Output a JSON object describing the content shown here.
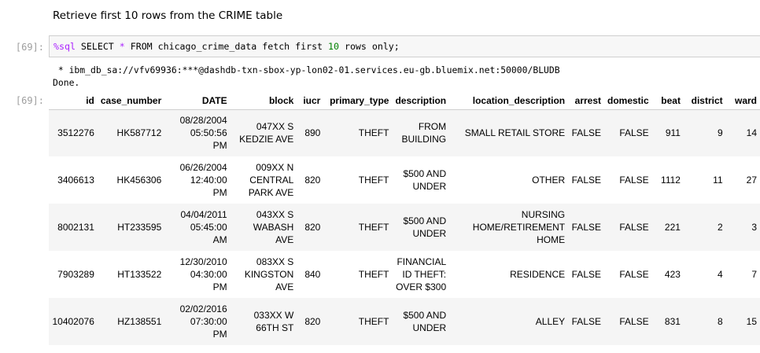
{
  "markdown": {
    "text": "Retrieve first 10 rows from the CRIME table"
  },
  "cell": {
    "in_prompt": "[69]:",
    "out_prompt": "[69]:",
    "code": {
      "magic": "%sql",
      "pre_star": " SELECT ",
      "star": "*",
      "mid": " FROM chicago_crime_data fetch first ",
      "num": "10",
      "post": " rows only;"
    },
    "stream": [
      " * ibm_db_sa://vfv69936:***@dashdb-txn-sbox-yp-lon02-01.services.eu-gb.bluemix.net:50000/BLUDB",
      "Done."
    ]
  },
  "table": {
    "columns": [
      "id",
      "case_number",
      "DATE",
      "block",
      "iucr",
      "primary_type",
      "description",
      "location_description",
      "arrest",
      "domestic",
      "beat",
      "district",
      "ward"
    ],
    "rows": [
      [
        [
          "3512276"
        ],
        [
          "HK587712"
        ],
        [
          "08/28/2004",
          "05:50:56",
          "PM"
        ],
        [
          "047XX S",
          "KEDZIE AVE"
        ],
        [
          "890"
        ],
        [
          "THEFT"
        ],
        [
          "FROM",
          "BUILDING"
        ],
        [
          "SMALL RETAIL STORE"
        ],
        [
          "FALSE"
        ],
        [
          "FALSE"
        ],
        [
          "911"
        ],
        [
          "9"
        ],
        [
          "14"
        ]
      ],
      [
        [
          "3406613"
        ],
        [
          "HK456306"
        ],
        [
          "06/26/2004",
          "12:40:00",
          "PM"
        ],
        [
          "009XX N",
          "CENTRAL",
          "PARK AVE"
        ],
        [
          "820"
        ],
        [
          "THEFT"
        ],
        [
          "$500 AND",
          "UNDER"
        ],
        [
          "OTHER"
        ],
        [
          "FALSE"
        ],
        [
          "FALSE"
        ],
        [
          "1112"
        ],
        [
          "11"
        ],
        [
          "27"
        ]
      ],
      [
        [
          "8002131"
        ],
        [
          "HT233595"
        ],
        [
          "04/04/2011",
          "05:45:00",
          "AM"
        ],
        [
          "043XX S",
          "WABASH AVE"
        ],
        [
          "820"
        ],
        [
          "THEFT"
        ],
        [
          "$500 AND",
          "UNDER"
        ],
        [
          "NURSING",
          "HOME/RETIREMENT",
          "HOME"
        ],
        [
          "FALSE"
        ],
        [
          "FALSE"
        ],
        [
          "221"
        ],
        [
          "2"
        ],
        [
          "3"
        ]
      ],
      [
        [
          "7903289"
        ],
        [
          "HT133522"
        ],
        [
          "12/30/2010",
          "04:30:00",
          "PM"
        ],
        [
          "083XX S",
          "KINGSTON",
          "AVE"
        ],
        [
          "840"
        ],
        [
          "THEFT"
        ],
        [
          "FINANCIAL",
          "ID THEFT:",
          "OVER $300"
        ],
        [
          "RESIDENCE"
        ],
        [
          "FALSE"
        ],
        [
          "FALSE"
        ],
        [
          "423"
        ],
        [
          "4"
        ],
        [
          "7"
        ]
      ],
      [
        [
          "10402076"
        ],
        [
          "HZ138551"
        ],
        [
          "02/02/2016",
          "07:30:00",
          "PM"
        ],
        [
          "033XX W",
          "66TH ST"
        ],
        [
          "820"
        ],
        [
          "THEFT"
        ],
        [
          "$500 AND",
          "UNDER"
        ],
        [
          "ALLEY"
        ],
        [
          "FALSE"
        ],
        [
          "FALSE"
        ],
        [
          "831"
        ],
        [
          "8"
        ],
        [
          "15"
        ]
      ]
    ]
  }
}
